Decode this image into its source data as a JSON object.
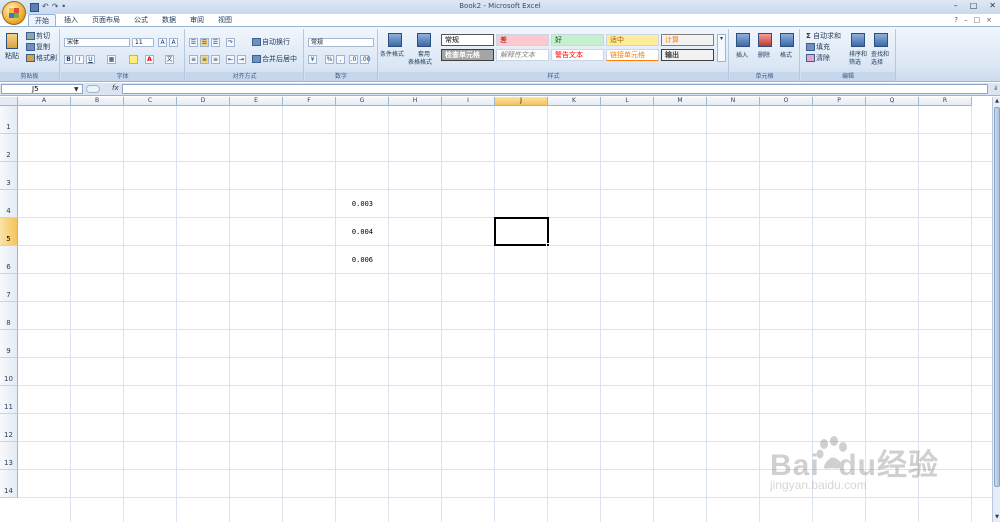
{
  "window": {
    "title": "Book2 - Microsoft Excel",
    "controls": [
      "–",
      "□",
      "✕"
    ]
  },
  "quick_access": {
    "save": "save-icon",
    "undo": "undo-icon",
    "redo": "redo-icon",
    "customize": "•"
  },
  "tabs": [
    {
      "label": "开始",
      "active": true
    },
    {
      "label": "插入"
    },
    {
      "label": "页面布局"
    },
    {
      "label": "公式"
    },
    {
      "label": "数据"
    },
    {
      "label": "审阅"
    },
    {
      "label": "视图"
    }
  ],
  "ribbon": {
    "clipboard": {
      "label": "剪贴板",
      "paste": "粘贴",
      "cut": "剪切",
      "copy": "复制",
      "format_painter": "格式刷"
    },
    "font": {
      "label": "字体",
      "name": "宋体",
      "size": "11",
      "bold": "B",
      "italic": "I",
      "underline": "U"
    },
    "alignment": {
      "label": "对齐方式",
      "wrap": "自动换行",
      "merge": "合并后居中"
    },
    "number": {
      "label": "数字",
      "format": "常规",
      "percent": "%",
      "comma": ","
    },
    "styles": {
      "label": "样式",
      "conditional": "条件格式",
      "table_line1": "套用",
      "table_line2": "表格格式",
      "cells": [
        "常规",
        "差",
        "好",
        "适中",
        "计算",
        "检查单元格",
        "解释性文本",
        "警告文本",
        "链接单元格",
        "输出"
      ]
    },
    "cells": {
      "label": "单元格",
      "insert": "插入",
      "delete": "删除",
      "format": "格式"
    },
    "editing": {
      "label": "编辑",
      "autosum": "自动求和",
      "fill": "填充",
      "clear": "清除",
      "sort_line1": "排序和",
      "sort_line2": "筛选",
      "find_line1": "查找和",
      "find_line2": "选择"
    }
  },
  "formula_bar": {
    "name_box": "J5",
    "fx": "fx",
    "formula": ""
  },
  "sheet": {
    "columns": [
      "A",
      "B",
      "C",
      "D",
      "E",
      "F",
      "G",
      "H",
      "I",
      "J",
      "K",
      "L",
      "M",
      "N",
      "O",
      "P",
      "Q",
      "R"
    ],
    "rows": [
      "1",
      "2",
      "3",
      "4",
      "5",
      "6",
      "7",
      "8",
      "9",
      "10",
      "11",
      "12",
      "13",
      "14"
    ],
    "selected_cell": "J5",
    "values": [
      {
        "cell": "G4",
        "value": "0.003"
      },
      {
        "cell": "G5",
        "value": "0.004"
      },
      {
        "cell": "G6",
        "value": "0.006"
      }
    ]
  },
  "watermark": {
    "main": "Bai  du经验",
    "sub": "jingyan.baidu.com"
  }
}
